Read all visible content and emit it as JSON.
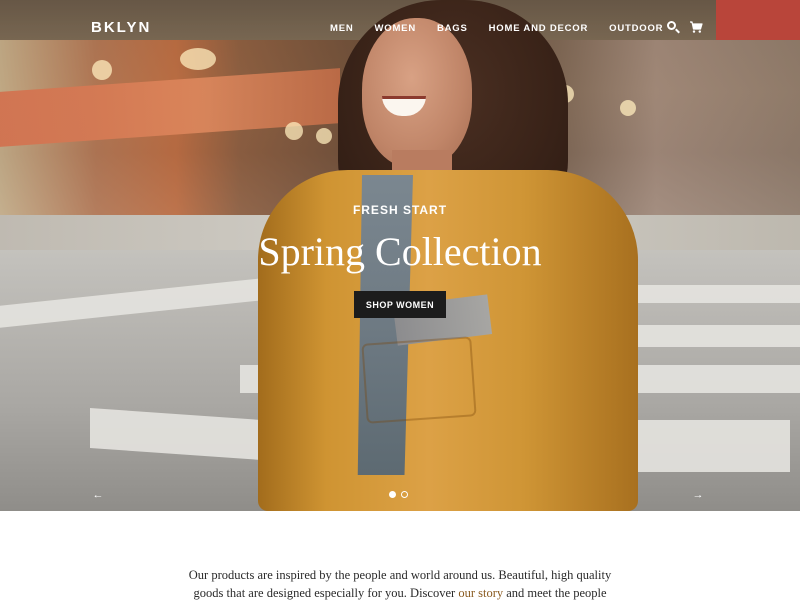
{
  "header": {
    "logo": "BKLYN",
    "nav": [
      {
        "label": "MEN"
      },
      {
        "label": "WOMEN"
      },
      {
        "label": "BAGS"
      },
      {
        "label": "HOME AND DECOR"
      },
      {
        "label": "OUTDOOR"
      }
    ],
    "icons": [
      "search-icon",
      "cart-icon"
    ]
  },
  "hero": {
    "eyebrow": "FRESH START",
    "headline": "Spring Collection",
    "cta_label": "SHOP WOMEN",
    "prev_arrow": "←",
    "next_arrow": "→",
    "slide_count": 2,
    "active_slide": 1
  },
  "intro": {
    "text_before": "Our products are inspired by the people and world around us. Beautiful, high quality goods that are designed especially for you. Discover ",
    "link_label": "our story",
    "text_after": " and meet the people"
  },
  "colors": {
    "cta_background": "#1c1c1c",
    "link": "#8a5a1f",
    "header_text": "#ffffff"
  }
}
